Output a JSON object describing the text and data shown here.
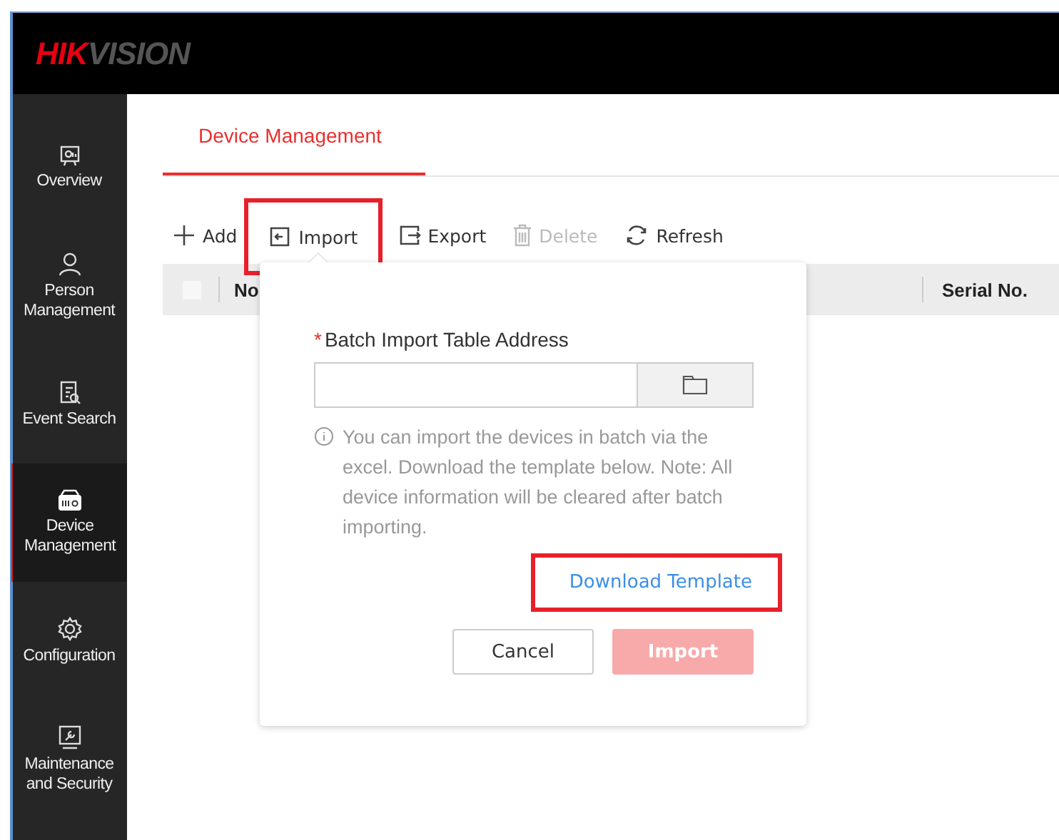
{
  "logo": {
    "part_1": "HIK",
    "part_2": "VISION"
  },
  "sidebar": {
    "items": [
      {
        "kind": "overview",
        "label": "Overview",
        "selected": false
      },
      {
        "kind": "person",
        "label": "Person Management",
        "selected": false
      },
      {
        "kind": "event",
        "label": "Event Search",
        "selected": false
      },
      {
        "kind": "device",
        "label": "Device Management",
        "selected": true
      },
      {
        "kind": "config",
        "label": "Configuration",
        "selected": false
      },
      {
        "kind": "maint",
        "label": "Maintenance and Security",
        "selected": false
      }
    ]
  },
  "tabs": [
    {
      "label": "Device Management",
      "selected": true
    }
  ],
  "toolbar": [
    {
      "kind": "add",
      "label": "Add",
      "disabled": false,
      "highlighted": false
    },
    {
      "kind": "import",
      "label": "Import",
      "disabled": false,
      "highlighted": true
    },
    {
      "kind": "export",
      "label": "Export",
      "disabled": false,
      "highlighted": false
    },
    {
      "kind": "delete",
      "label": "Delete",
      "disabled": true,
      "highlighted": false
    },
    {
      "kind": "refresh",
      "label": "Refresh",
      "disabled": false,
      "highlighted": false
    }
  ],
  "table": {
    "select_all_checked": false,
    "columns": [
      "No",
      "Serial No."
    ]
  },
  "import_popover": {
    "label": "Batch Import Table Address",
    "required_mark": "*",
    "info": "You can import the devices in batch via the excel. Download the template below. Note: All device information will be cleared after batch importing.",
    "link": {
      "label": "Download Template",
      "highlighted": true
    },
    "buttons": [
      {
        "kind": "secondary",
        "label": "Cancel",
        "disabled": false
      },
      {
        "kind": "primary",
        "label": "Import",
        "disabled": true
      }
    ]
  }
}
